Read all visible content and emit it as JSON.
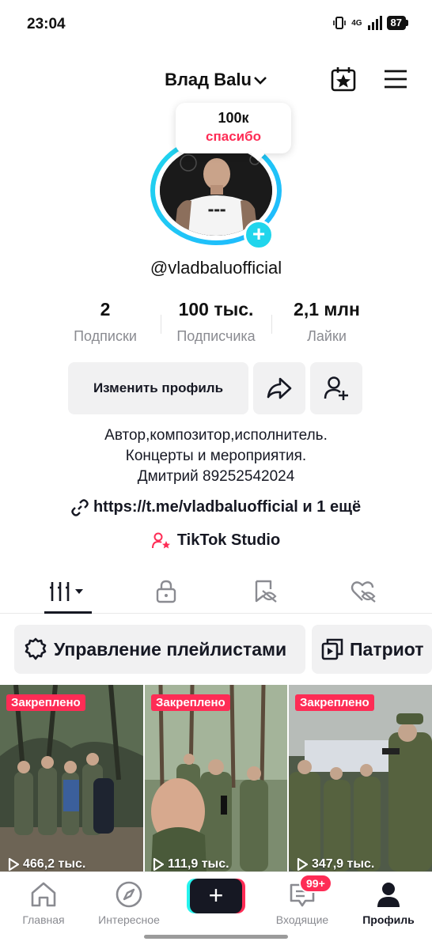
{
  "status_bar": {
    "time": "23:04",
    "network": "4G",
    "battery": "87"
  },
  "header": {
    "username": "Влад Balu"
  },
  "avatar": {
    "bubble_count": "100к",
    "bubble_thanks": "спасибо"
  },
  "profile": {
    "handle": "@vladbaluofficial"
  },
  "stats": [
    {
      "value": "2",
      "label": "Подписки"
    },
    {
      "value": "100 тыс.",
      "label": "Подписчика"
    },
    {
      "value": "2,1 млн",
      "label": "Лайки"
    }
  ],
  "buttons": {
    "edit_profile": "Изменить профиль"
  },
  "bio": {
    "line1": "Автор,композитор,исполнитель.",
    "line2": "Концерты и мероприятия.",
    "line3": "Дмитрий 89252542024"
  },
  "link": {
    "text": "https://t.me/vladbaluofficial и 1 ещё"
  },
  "studio": {
    "label": "TikTok Studio"
  },
  "playlists": [
    {
      "label": "Управление плейлистами"
    },
    {
      "label": "Патриот"
    }
  ],
  "videos": [
    {
      "pinned": "Закреплено",
      "views": "466,2 тыс."
    },
    {
      "pinned": "Закреплено",
      "views": "111,9 тыс."
    },
    {
      "pinned": "Закреплено",
      "views": "347,9 тыс."
    }
  ],
  "bottom_nav": {
    "home": "Главная",
    "discover": "Интересное",
    "inbox": "Входящие",
    "inbox_badge": "99+",
    "profile": "Профиль"
  },
  "colors": {
    "accent": "#fe2c55",
    "cyan": "#20d5ec",
    "text": "#161823",
    "muted": "#8a8b91"
  }
}
